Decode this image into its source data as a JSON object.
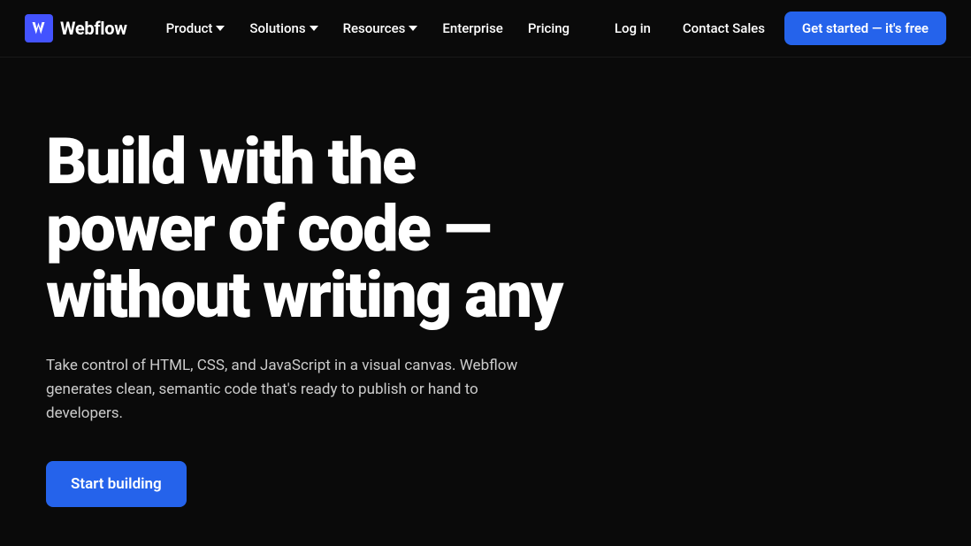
{
  "brand": {
    "name": "Webflow"
  },
  "nav": {
    "links": [
      {
        "label": "Product",
        "hasDropdown": true
      },
      {
        "label": "Solutions",
        "hasDropdown": true
      },
      {
        "label": "Resources",
        "hasDropdown": true
      },
      {
        "label": "Enterprise",
        "hasDropdown": false
      },
      {
        "label": "Pricing",
        "hasDropdown": false
      }
    ],
    "right": {
      "login": "Log in",
      "contact": "Contact Sales",
      "cta": "Get started — it's free"
    }
  },
  "hero": {
    "heading": "Build with the power of code — without writing any",
    "subtext": "Take control of HTML, CSS, and JavaScript in a visual canvas. Webflow generates clean, semantic code that's ready to publish or hand to developers.",
    "cta": "Start building"
  }
}
